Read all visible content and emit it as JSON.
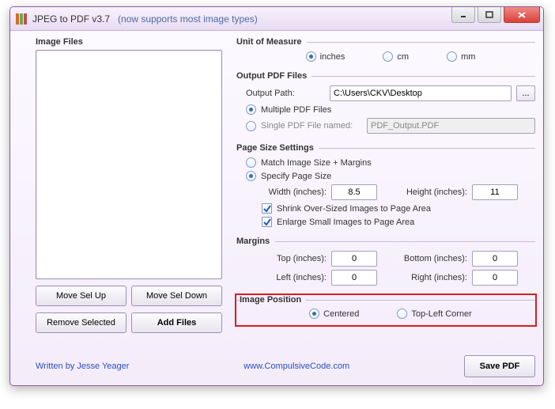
{
  "titlebar": {
    "title": "JPEG to PDF  v3.7",
    "subtitle": "(now supports most image types)"
  },
  "left": {
    "heading": "Image Files",
    "move_up": "Move Sel Up",
    "move_down": "Move Sel Down",
    "remove": "Remove Selected",
    "add": "Add Files"
  },
  "unit": {
    "heading": "Unit of Measure",
    "inches": "inches",
    "cm": "cm",
    "mm": "mm"
  },
  "output": {
    "heading": "Output PDF Files",
    "path_label": "Output Path:",
    "path_value": "C:\\Users\\CKV\\Desktop",
    "browse": "...",
    "multiple": "Multiple PDF Files",
    "single": "Single PDF File named:",
    "single_name": "PDF_Output.PDF"
  },
  "page": {
    "heading": "Page Size Settings",
    "match": "Match Image Size + Margins",
    "specify": "Specify Page Size",
    "width_label": "Width (inches):",
    "width_value": "8.5",
    "height_label": "Height (inches):",
    "height_value": "11",
    "shrink": "Shrink Over-Sized Images to Page Area",
    "enlarge": "Enlarge Small Images to Page Area"
  },
  "margins": {
    "heading": "Margins",
    "top_label": "Top (inches):",
    "top_value": "0",
    "bottom_label": "Bottom (inches):",
    "bottom_value": "0",
    "left_label": "Left (inches):",
    "left_value": "0",
    "right_label": "Right (inches):",
    "right_value": "0"
  },
  "position": {
    "heading": "Image Position",
    "centered": "Centered",
    "topleft": "Top-Left Corner"
  },
  "footer": {
    "author": "Written by Jesse Yeager",
    "site": "www.CompulsiveCode.com",
    "save": "Save PDF"
  }
}
